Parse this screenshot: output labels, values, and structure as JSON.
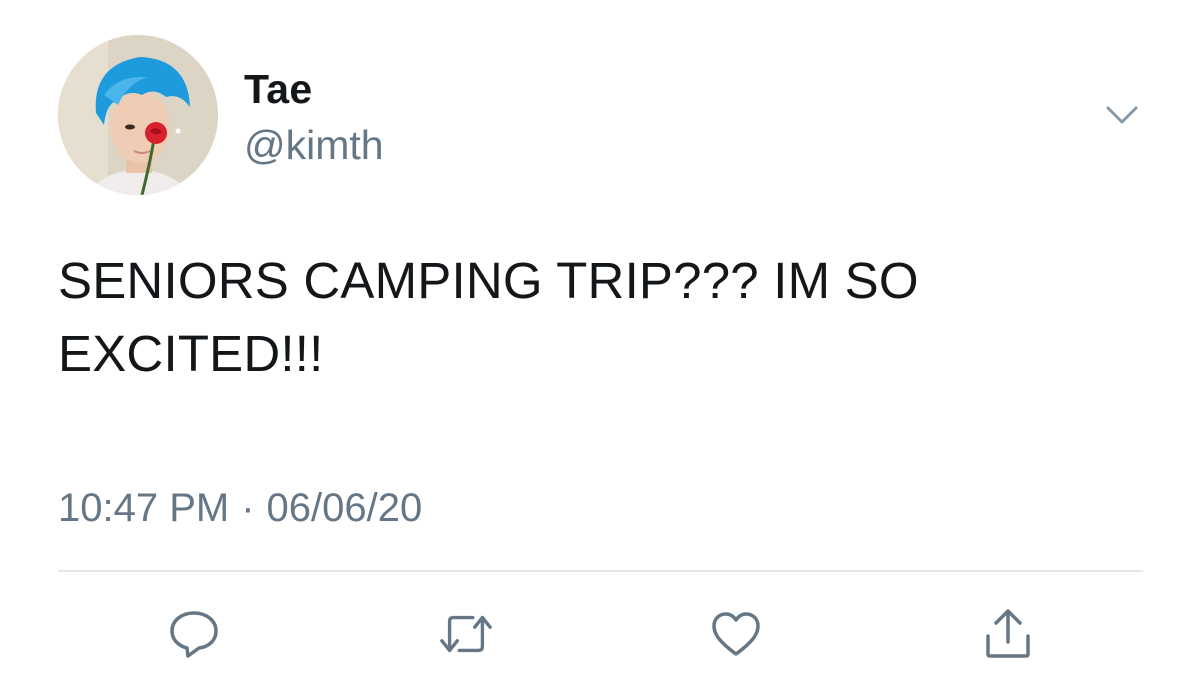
{
  "author": {
    "display_name": "Tae",
    "handle": "@kimth",
    "avatar_icon": "profile-photo"
  },
  "tweet": {
    "text": "SENIORS CAMPING TRIP??? IM SO EXCITED!!!",
    "time": "10:47 PM",
    "separator": "·",
    "date": "06/06/20"
  },
  "actions": {
    "menu_icon": "chevron-down-icon",
    "reply_icon": "reply-icon",
    "retweet_icon": "retweet-icon",
    "like_icon": "heart-icon",
    "share_icon": "share-icon"
  },
  "colors": {
    "text": "#14171a",
    "secondary": "#657786",
    "divider": "#e1e8ed",
    "hair": "#1e9bdc",
    "rose": "#d8202f"
  }
}
